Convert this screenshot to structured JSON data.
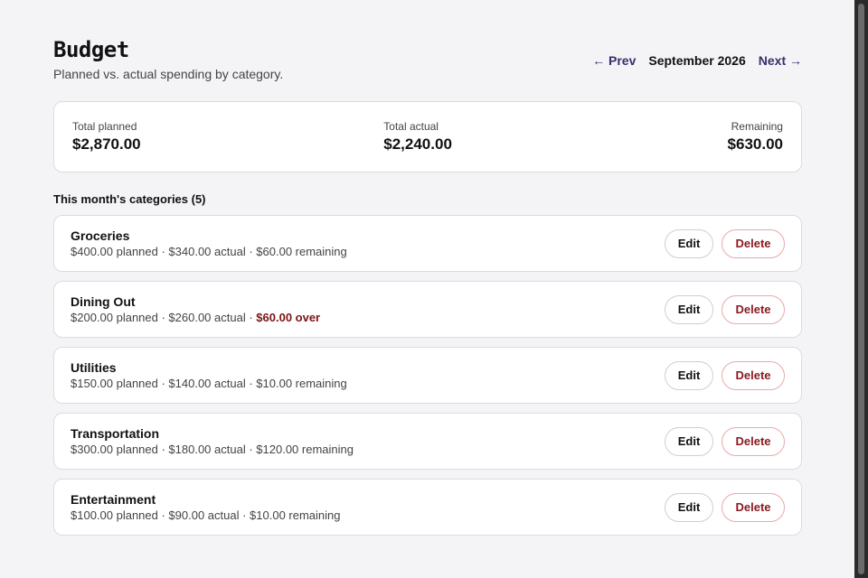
{
  "header": {
    "title": "Budget",
    "subtitle": "Planned vs. actual spending by category.",
    "prev_label": "← Prev",
    "month": "September 2026",
    "next_label": "Next →"
  },
  "summary": {
    "planned_label": "Total planned",
    "planned_value": "$2,870.00",
    "actual_label": "Total actual",
    "actual_value": "$2,240.00",
    "remaining_label": "Remaining",
    "remaining_value": "$630.00"
  },
  "section_title": "This month's categories (5)",
  "categories": [
    {
      "name": "Groceries",
      "detail": "$400.00 planned · $340.00 actual · ",
      "status": "$60.00 remaining",
      "over": false
    },
    {
      "name": "Dining Out",
      "detail": "$200.00 planned · $260.00 actual · ",
      "status": "$60.00 over",
      "over": true
    },
    {
      "name": "Utilities",
      "detail": "$150.00 planned · $140.00 actual · ",
      "status": "$10.00 remaining",
      "over": false
    },
    {
      "name": "Transportation",
      "detail": "$300.00 planned · $180.00 actual · ",
      "status": "$120.00 remaining",
      "over": false
    },
    {
      "name": "Entertainment",
      "detail": "$100.00 planned · $90.00 actual · ",
      "status": "$10.00 remaining",
      "over": false
    }
  ],
  "actions": {
    "edit_label": "Edit",
    "delete_label": "Delete"
  },
  "colors": {
    "accent": "#3b2d6e",
    "over": "#7a1414",
    "danger_border": "#e8a9ac"
  }
}
